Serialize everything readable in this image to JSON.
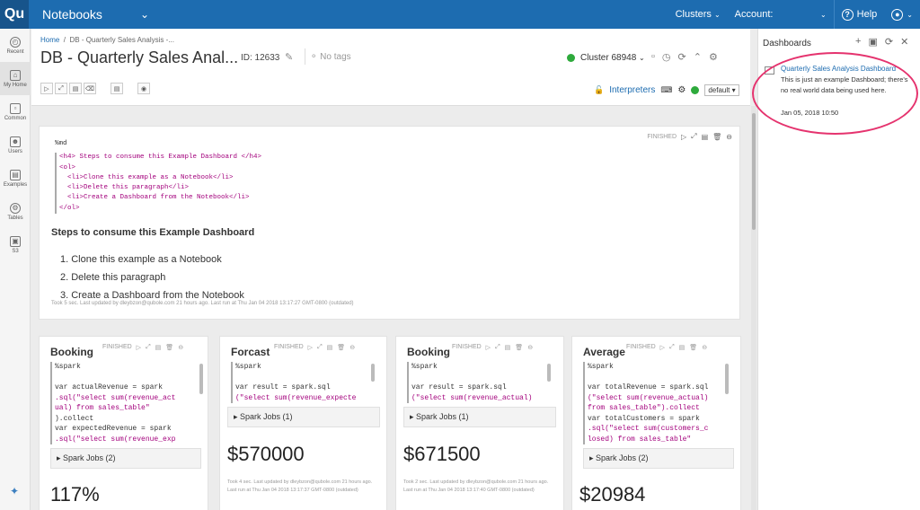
{
  "topbar": {
    "logo": "Qu",
    "app_name": "Notebooks",
    "clusters_label": "Clusters",
    "account_label": "Account:",
    "help_label": "Help"
  },
  "leftnav": [
    {
      "label": "Recent",
      "icon": "clock-icon"
    },
    {
      "label": "My Home",
      "icon": "home-icon"
    },
    {
      "label": "Common",
      "icon": "folder-icon"
    },
    {
      "label": "Users",
      "icon": "users-icon"
    },
    {
      "label": "Examples",
      "icon": "book-icon"
    },
    {
      "label": "Tables",
      "icon": "table-icon"
    },
    {
      "label": "S3",
      "icon": "cube-icon"
    }
  ],
  "header": {
    "breadcrumb_home": "Home",
    "breadcrumb_sep": "/",
    "breadcrumb_current": "DB - Quarterly Sales Analysis -...",
    "title": "DB - Quarterly Sales Anal...",
    "id_label": "ID: 12633",
    "tags_placeholder": "No tags",
    "cluster": "Cluster 68948",
    "interpreters_label": "Interpreters",
    "interp_select": "default"
  },
  "status_colors": {
    "running": "#2eaa3c",
    "accent": "#1d6cb0",
    "highlight": "#e5336e"
  },
  "markdown_paragraph": {
    "status": "FINISHED",
    "code_lines": [
      "%md",
      "",
      "<h4> Steps to consume this Example Dashboard </h4>",
      "<ol>",
      "  <li>Clone this example as a Notebook</li>",
      "  <li>Delete this paragraph</li>",
      "  <li>Create a Dashboard from the Notebook</li>",
      "</ol>"
    ],
    "heading": "Steps to consume this Example Dashboard",
    "list": [
      "Clone this example as a Notebook",
      "Delete this paragraph",
      "Create a Dashboard from the Notebook"
    ],
    "footer": "Took 5 sec. Last updated by dleybzon@qubole.com 21 hours ago. Last run at Thu Jan 04 2018 13:17:27 GMT-0800 (outdated)"
  },
  "cards": [
    {
      "title": "Booking",
      "status": "FINISHED",
      "code": [
        "%spark",
        "",
        "var actualRevenue = spark",
        ".sql(\"select sum(revenue_act",
        "ual) from sales_table\"",
        ").collect",
        "var expectedRevenue = spark",
        ".sql(\"select sum(revenue_exp"
      ],
      "jobs": "Spark Jobs (2)",
      "value": "117%",
      "footer": ""
    },
    {
      "title": "Forcast",
      "status": "FINISHED",
      "code": [
        "%spark",
        "",
        "var result = spark.sql",
        "(\"select sum(revenue_expecte"
      ],
      "jobs": "Spark Jobs (1)",
      "value": "$570000",
      "footer": "Took 4 sec. Last updated by dleybzon@qubole.com 21 hours ago. Last run at Thu Jan 04 2018 13:17:37 GMT-0800 (outdated)"
    },
    {
      "title": "Booking",
      "status": "FINISHED",
      "code": [
        "%spark",
        "",
        "var result = spark.sql",
        "(\"select sum(revenue_actual)"
      ],
      "jobs": "Spark Jobs (1)",
      "value": "$671500",
      "footer": "Took 2 sec. Last updated by dleybzon@qubole.com 21 hours ago. Last run at Thu Jan 04 2018 13:17:40 GMT-0800 (outdated)"
    },
    {
      "title": "Average",
      "status": "FINISHED",
      "code": [
        "%spark",
        "",
        "var totalRevenue = spark.sql",
        "(\"select sum(revenue_actual)",
        "from sales_table\").collect",
        "var totalCustomers = spark",
        ".sql(\"select sum(customers_c",
        "losed) from sales_table\""
      ],
      "jobs": "Spark Jobs (2)",
      "value": "$20984",
      "footer": ""
    }
  ],
  "dashboards_panel": {
    "title": "Dashboards",
    "item": {
      "name": "Quarterly Sales Analysis Dashboard",
      "description": "This is just an example Dashboard; there's no real world data being used here.",
      "date": "Jan 05, 2018 10:50"
    }
  }
}
